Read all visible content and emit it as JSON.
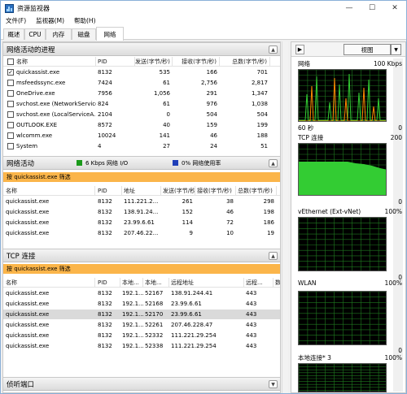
{
  "title": "资源监视器",
  "window_controls": {
    "minimize": "—",
    "maximize": "☐",
    "close": "✕"
  },
  "menu": [
    "文件(F)",
    "监视器(M)",
    "帮助(H)"
  ],
  "tabs": [
    "概述",
    "CPU",
    "内存",
    "磁盘",
    "网络"
  ],
  "active_tab": "网络",
  "proc_section": {
    "title": "网络活动的进程",
    "columns": [
      "名称",
      "PID",
      "发送(字节/秒)",
      "接收(字节/秒)",
      "总数(字节/秒)"
    ],
    "rows": [
      {
        "checked": true,
        "name": "quickassist.exe",
        "pid": "8132",
        "send": "535",
        "recv": "166",
        "total": "701"
      },
      {
        "checked": false,
        "name": "msfeedssync.exe",
        "pid": "7424",
        "send": "61",
        "recv": "2,756",
        "total": "2,817"
      },
      {
        "checked": false,
        "name": "OneDrive.exe",
        "pid": "7956",
        "send": "1,056",
        "recv": "291",
        "total": "1,347"
      },
      {
        "checked": false,
        "name": "svchost.exe (NetworkService)",
        "pid": "824",
        "send": "61",
        "recv": "976",
        "total": "1,038"
      },
      {
        "checked": false,
        "name": "svchost.exe (LocalServiceA...",
        "pid": "2104",
        "send": "0",
        "recv": "504",
        "total": "504"
      },
      {
        "checked": false,
        "name": "OUTLOOK.EXE",
        "pid": "8572",
        "send": "40",
        "recv": "159",
        "total": "199"
      },
      {
        "checked": false,
        "name": "wlcomm.exe",
        "pid": "10024",
        "send": "141",
        "recv": "46",
        "total": "188"
      },
      {
        "checked": false,
        "name": "System",
        "pid": "4",
        "send": "27",
        "recv": "24",
        "total": "51"
      }
    ]
  },
  "net_section": {
    "title": "网络活动",
    "io": "6 Kbps 网络 I/O",
    "usage": "0% 网络使用率",
    "filter": "按 quickassist.exe 筛选",
    "columns": [
      "名称",
      "PID",
      "地址",
      "发送(字节/秒)",
      "接收(字节/秒)",
      "总数(字节/秒)"
    ],
    "rows": [
      {
        "name": "quickassist.exe",
        "pid": "8132",
        "addr": "111.221.2...",
        "send": "261",
        "recv": "38",
        "total": "298"
      },
      {
        "name": "quickassist.exe",
        "pid": "8132",
        "addr": "138.91.24...",
        "send": "152",
        "recv": "46",
        "total": "198"
      },
      {
        "name": "quickassist.exe",
        "pid": "8132",
        "addr": "23.99.6.61",
        "send": "114",
        "recv": "72",
        "total": "186"
      },
      {
        "name": "quickassist.exe",
        "pid": "8132",
        "addr": "207.46.22...",
        "send": "9",
        "recv": "10",
        "total": "19"
      }
    ]
  },
  "tcp_section": {
    "title": "TCP 连接",
    "filter": "按 quickassist.exe 筛选",
    "columns": [
      "名称",
      "PID",
      "本地...",
      "本地...",
      "远程地址",
      "远程...",
      "数"
    ],
    "rows": [
      {
        "name": "quickassist.exe",
        "pid": "8132",
        "laddr": "192.1...",
        "lport": "52167",
        "raddr": "138.91.244.41",
        "rport": "443",
        "sel": false
      },
      {
        "name": "quickassist.exe",
        "pid": "8132",
        "laddr": "192.1...",
        "lport": "52168",
        "raddr": "23.99.6.61",
        "rport": "443",
        "sel": false
      },
      {
        "name": "quickassist.exe",
        "pid": "8132",
        "laddr": "192.1...",
        "lport": "52170",
        "raddr": "23.99.6.61",
        "rport": "443",
        "sel": true
      },
      {
        "name": "quickassist.exe",
        "pid": "8132",
        "laddr": "192.1...",
        "lport": "52261",
        "raddr": "207.46.228.47",
        "rport": "443",
        "sel": false
      },
      {
        "name": "quickassist.exe",
        "pid": "8132",
        "laddr": "192.1...",
        "lport": "52332",
        "raddr": "111.221.29.254",
        "rport": "443",
        "sel": false
      },
      {
        "name": "quickassist.exe",
        "pid": "8132",
        "laddr": "192.1...",
        "lport": "52338",
        "raddr": "111.221.29.254",
        "rport": "443",
        "sel": false
      }
    ]
  },
  "listen_section": {
    "title": "侦听端口"
  },
  "right": {
    "view_label": "视图",
    "graphs": [
      {
        "label": "网络",
        "value": "100 Kbps",
        "bottom_left": "60 秒",
        "bottom_right": "0"
      },
      {
        "label": "TCP 连接",
        "value": "200",
        "bottom_left": "",
        "bottom_right": "0"
      },
      {
        "label": "vEthernet (Ext-vNet)",
        "value": "100%",
        "bottom_left": "",
        "bottom_right": "0"
      },
      {
        "label": "WLAN",
        "value": "100%",
        "bottom_left": "",
        "bottom_right": "0"
      },
      {
        "label": "本地连接* 3",
        "value": "100%",
        "bottom_left": "",
        "bottom_right": ""
      }
    ]
  },
  "colors": {
    "section_orange": "#fbb54a",
    "graph_bg": "#000000",
    "graph_grid": "#1f7a1f",
    "graph_green": "#33cc33",
    "graph_orange": "#ff8800",
    "legend_green": "#1a9a1a",
    "legend_blue": "#1f3fb8"
  }
}
